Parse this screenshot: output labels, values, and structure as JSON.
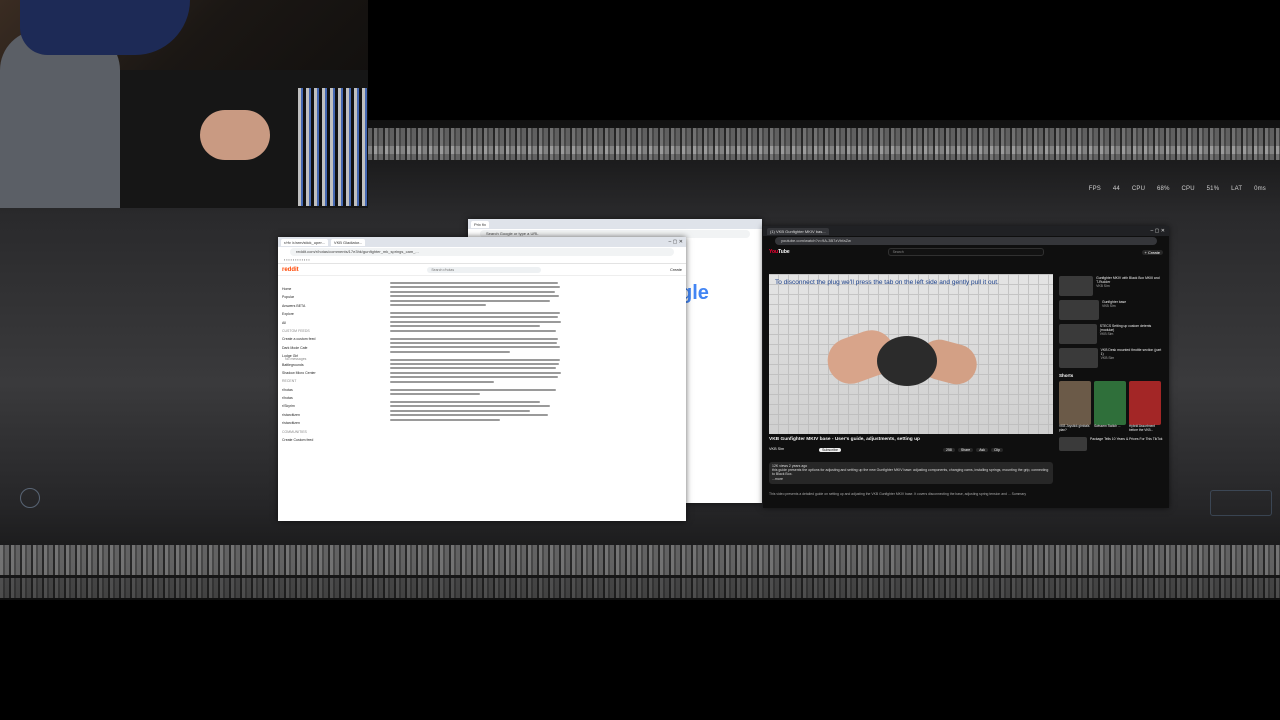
{
  "hud": {
    "fps_label": "FPS",
    "fps": "44",
    "cpu_label": "CPU",
    "cpu": "68%",
    "cpu2_label": "CPU",
    "cpu2": "51%",
    "lat_label": "LAT",
    "lat": "0ms"
  },
  "google_window": {
    "tab": "Prix fix",
    "address": "Search Google or type a URL",
    "logo": "gle"
  },
  "reddit_window": {
    "tabs": [
      "r/rfv /r/arm/stick_uper...",
      "VKB Gladiator..."
    ],
    "address": "reddit.com/r/hotas/comments/17e3hk/gunfighter_mk_springs_cam_...",
    "logo": "reddit",
    "search_placeholder": "Search r/hotas",
    "create": "Create",
    "nav_items": [
      "Home",
      "Popular",
      "Answers BETA",
      "Explore",
      "All"
    ],
    "sections": {
      "custom_feeds": "Custom feeds",
      "recent": "Recent",
      "communities": "Communities"
    },
    "community_items": [
      "Create a custom feed",
      "Dark Mode Cafe",
      "Lodge Girl",
      "Battlegrounds",
      "Shadow Micro Center"
    ],
    "recent_items": [
      "r/hotas",
      "r/hotas",
      "r/Skyrim",
      "r/starcitizen",
      "r/starcitizen"
    ],
    "create_community": "Create Custom feed",
    "no_messages": "No messages"
  },
  "youtube_window": {
    "tab": "(1) VKB Gunfighter MKIV bas...",
    "address": "youtube.com/watch?v=9A-3B7zVhfaZw",
    "logo_prefix": "You",
    "logo_suffix": "Tube",
    "search_placeholder": "Search",
    "create": "+ Create",
    "caption": "To disconnect the plug we'll press the tab on the left side and gently pull it out.",
    "title": "VKB Gunfighter MKIV base - User's guide, adjustments, setting up",
    "channel": "VKB Sim",
    "subscribe": "Subscribe",
    "actions": [
      "258",
      "Share",
      "Ask",
      "Clip"
    ],
    "desc_views": "12K views  2 years ago",
    "desc_text": "this guide presents the options for adjusting and setting up the new Gunfighter MKIV base: adjusting components, changing cams, installing springs, mounting the grip, connecting to Black Box.",
    "desc_more": "...more",
    "desc_footer": "This video presents a detailed guide on setting up and adjusting the VKB Gunfighter MKIV base. It covers disconnecting the base, adjusting spring tension and ...  Summary",
    "recommended": [
      {
        "title": "Gunfighter MKIV with Black Box MKIII and T-Rudder",
        "channel": "VKB Sim"
      },
      {
        "title": "Gunfighter base",
        "channel": "VKB Sim"
      },
      {
        "title": "STECS Setting up custom detents (modular)",
        "channel": "VKB Sim"
      },
      {
        "title": "VKB Desk mounted throttle section (part 1)",
        "channel": "VKB Sim"
      }
    ],
    "shorts_title": "Shorts",
    "shorts": [
      "VKB Joystick gimbals plan?",
      "Swissem Switch ...",
      "Hybrid Assortment before the VKB..."
    ],
    "last_rec": "Package Tells 10 Years & Prices For This TikTok"
  }
}
